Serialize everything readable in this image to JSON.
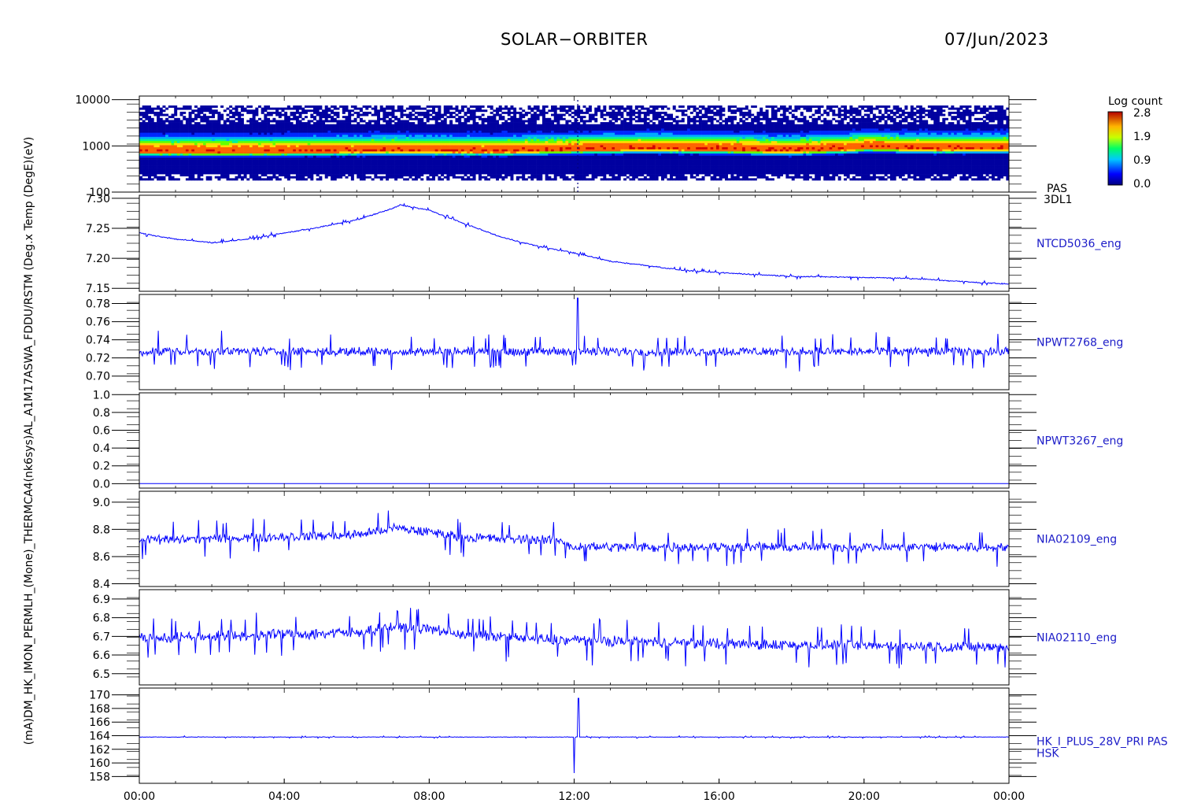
{
  "header": {
    "mission": "SOLAR−ORBITER",
    "date": "07/Jun/2023"
  },
  "left_axis_text": "(mA)DM_HK_IMON_PERMLH_(Mone)_THERMCA4(nk6sys)AL_A1M17ASWA_FDDU/RSTM (Deg.x Temp (DegE)(eV)",
  "colorbar": {
    "title": "Log count",
    "ticks": [
      "2.8",
      "1.9",
      "0.9",
      "0.0"
    ]
  },
  "x_axis": {
    "ticks": [
      "00:00",
      "04:00",
      "08:00",
      "12:00",
      "16:00",
      "20:00",
      "00:00"
    ],
    "range_hours": [
      0,
      24
    ]
  },
  "chart_data": [
    {
      "type": "heatmap",
      "panel_label": [
        "PAS",
        "3DL1"
      ],
      "ylabel": "(eV)",
      "yscale": "log",
      "ylim": [
        100,
        12000
      ],
      "yticks": [
        "10000",
        "1000",
        "100"
      ],
      "colorbar_range": [
        0.0,
        2.8
      ],
      "peak_energy_eV_vs_time": {
        "x_hours": [
          0,
          2,
          4,
          6,
          7,
          8,
          10,
          12,
          14,
          16,
          18,
          19.5,
          20,
          22,
          24
        ],
        "y": [
          780,
          760,
          770,
          800,
          820,
          800,
          790,
          850,
          900,
          860,
          800,
          880,
          950,
          880,
          900
        ]
      },
      "count_range_eV": [
        180,
        7500
      ]
    },
    {
      "type": "line",
      "series": [
        {
          "name": "NTCD5036_eng"
        }
      ],
      "ylabel": "Temp (Deg)",
      "ylim": [
        7.145,
        7.305
      ],
      "yticks": [
        "7.30",
        "7.25",
        "7.20",
        "7.15"
      ],
      "x_hours": [
        0,
        1,
        2,
        3,
        4,
        5,
        6,
        7,
        7.2,
        8,
        9,
        10,
        11,
        12,
        13,
        14,
        15,
        16,
        17,
        18,
        19,
        20,
        21,
        22,
        23,
        24
      ],
      "values": [
        7.242,
        7.232,
        7.226,
        7.232,
        7.242,
        7.252,
        7.264,
        7.283,
        7.289,
        7.28,
        7.257,
        7.235,
        7.22,
        7.209,
        7.195,
        7.188,
        7.18,
        7.176,
        7.173,
        7.17,
        7.169,
        7.168,
        7.167,
        7.164,
        7.16,
        7.157
      ],
      "noise": 0.0035
    },
    {
      "type": "line",
      "series": [
        {
          "name": "NPWT2768_eng"
        }
      ],
      "ylim": [
        0.685,
        0.79
      ],
      "yticks": [
        "0.78",
        "0.76",
        "0.74",
        "0.72",
        "0.70"
      ],
      "x_hours": [
        0,
        24
      ],
      "values": [
        0.727,
        0.727
      ],
      "noise": 0.017,
      "spike": {
        "x_hours": 12.1,
        "value": 0.786
      }
    },
    {
      "type": "line",
      "series": [
        {
          "name": "NPWT3267_eng"
        }
      ],
      "ylim": [
        -0.05,
        1.02
      ],
      "yticks": [
        "1.0",
        "0.8",
        "0.6",
        "0.4",
        "0.2",
        "0.0"
      ],
      "x_hours": [
        0,
        24
      ],
      "values": [
        0.0,
        0.0
      ],
      "noise": 0.0
    },
    {
      "type": "line",
      "series": [
        {
          "name": "NIA02109_eng"
        }
      ],
      "ylim": [
        8.38,
        9.08
      ],
      "yticks": [
        "9.0",
        "8.8",
        "8.6",
        "8.4"
      ],
      "x_hours": [
        0,
        6,
        7,
        8,
        9,
        11.5,
        12,
        24
      ],
      "values": [
        8.72,
        8.76,
        8.81,
        8.78,
        8.74,
        8.72,
        8.67,
        8.67
      ],
      "noise": 0.12
    },
    {
      "type": "line",
      "series": [
        {
          "name": "NIA02110_eng"
        }
      ],
      "ylim": [
        6.44,
        6.95
      ],
      "yticks": [
        "6.9",
        "6.8",
        "6.7",
        "6.6",
        "6.5"
      ],
      "x_hours": [
        0,
        6,
        7,
        8,
        9,
        11.5,
        12,
        16,
        24
      ],
      "values": [
        6.69,
        6.72,
        6.75,
        6.74,
        6.71,
        6.68,
        6.68,
        6.66,
        6.64
      ],
      "noise": 0.1
    },
    {
      "type": "line",
      "series": [
        {
          "name": "HK_I_PLUS_28V_PRI PAS"
        }
      ],
      "panel_label_extra": "HSK",
      "ylabel": "(mA)",
      "ylim": [
        157,
        171
      ],
      "yticks": [
        "170",
        "168",
        "166",
        "164",
        "162",
        "160",
        "158"
      ],
      "x_hours": [
        0,
        24
      ],
      "values": [
        163.8,
        163.8
      ],
      "noise": 0.15,
      "glitch": {
        "x_hours": 12.0,
        "min": 158.5,
        "max": 169.5
      }
    }
  ]
}
